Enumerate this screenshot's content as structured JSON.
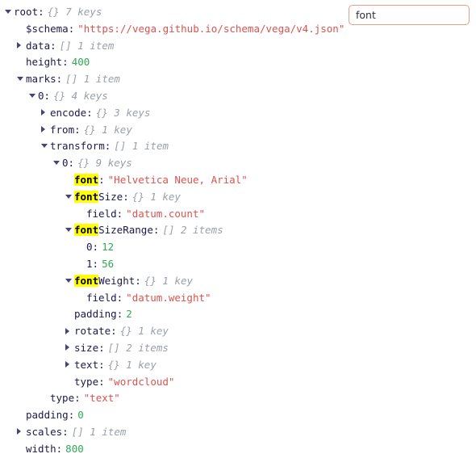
{
  "search": {
    "value": "font",
    "placeholder": "",
    "name": "search-input"
  },
  "tree": {
    "rows": [
      {
        "indent": 0,
        "toggle": "open",
        "key": "root",
        "hlen": 0,
        "meta": "{}  7 keys",
        "value": "",
        "valueType": "none"
      },
      {
        "indent": 1,
        "toggle": "none",
        "key": "$schema",
        "hlen": 0,
        "meta": "",
        "value": "\"https://vega.github.io/schema/vega/v4.json\"",
        "valueType": "string"
      },
      {
        "indent": 1,
        "toggle": "closed",
        "key": "data",
        "hlen": 0,
        "meta": "[]  1 item",
        "value": "",
        "valueType": "none"
      },
      {
        "indent": 1,
        "toggle": "none",
        "key": "height",
        "hlen": 0,
        "meta": "",
        "value": "400",
        "valueType": "number"
      },
      {
        "indent": 1,
        "toggle": "open",
        "key": "marks",
        "hlen": 0,
        "meta": "[]  1 item",
        "value": "",
        "valueType": "none"
      },
      {
        "indent": 2,
        "toggle": "open",
        "key": "0",
        "hlen": 0,
        "meta": "{}  4 keys",
        "value": "",
        "valueType": "none"
      },
      {
        "indent": 3,
        "toggle": "closed",
        "key": "encode",
        "hlen": 0,
        "meta": "{}  3 keys",
        "value": "",
        "valueType": "none"
      },
      {
        "indent": 3,
        "toggle": "closed",
        "key": "from",
        "hlen": 0,
        "meta": "{}  1 key",
        "value": "",
        "valueType": "none"
      },
      {
        "indent": 3,
        "toggle": "open",
        "key": "transform",
        "hlen": 0,
        "meta": "[]  1 item",
        "value": "",
        "valueType": "none"
      },
      {
        "indent": 4,
        "toggle": "open",
        "key": "0",
        "hlen": 0,
        "meta": "{}  9 keys",
        "value": "",
        "valueType": "none"
      },
      {
        "indent": 5,
        "toggle": "none",
        "key": "font",
        "hlen": 4,
        "meta": "",
        "value": "\"Helvetica Neue, Arial\"",
        "valueType": "string"
      },
      {
        "indent": 5,
        "toggle": "open",
        "key": "fontSize",
        "hlen": 4,
        "meta": "{}  1 key",
        "value": "",
        "valueType": "none"
      },
      {
        "indent": 6,
        "toggle": "none",
        "key": "field",
        "hlen": 0,
        "meta": "",
        "value": "\"datum.count\"",
        "valueType": "string"
      },
      {
        "indent": 5,
        "toggle": "open",
        "key": "fontSizeRange",
        "hlen": 4,
        "meta": "[]  2 items",
        "value": "",
        "valueType": "none"
      },
      {
        "indent": 6,
        "toggle": "none",
        "key": "0",
        "hlen": 0,
        "meta": "",
        "value": "12",
        "valueType": "number"
      },
      {
        "indent": 6,
        "toggle": "none",
        "key": "1",
        "hlen": 0,
        "meta": "",
        "value": "56",
        "valueType": "number"
      },
      {
        "indent": 5,
        "toggle": "open",
        "key": "fontWeight",
        "hlen": 4,
        "meta": "{}  1 key",
        "value": "",
        "valueType": "none"
      },
      {
        "indent": 6,
        "toggle": "none",
        "key": "field",
        "hlen": 0,
        "meta": "",
        "value": "\"datum.weight\"",
        "valueType": "string"
      },
      {
        "indent": 5,
        "toggle": "none",
        "key": "padding",
        "hlen": 0,
        "meta": "",
        "value": "2",
        "valueType": "number"
      },
      {
        "indent": 5,
        "toggle": "closed",
        "key": "rotate",
        "hlen": 0,
        "meta": "{}  1 key",
        "value": "",
        "valueType": "none"
      },
      {
        "indent": 5,
        "toggle": "closed",
        "key": "size",
        "hlen": 0,
        "meta": "[]  2 items",
        "value": "",
        "valueType": "none"
      },
      {
        "indent": 5,
        "toggle": "closed",
        "key": "text",
        "hlen": 0,
        "meta": "{}  1 key",
        "value": "",
        "valueType": "none"
      },
      {
        "indent": 5,
        "toggle": "none",
        "key": "type",
        "hlen": 0,
        "meta": "",
        "value": "\"wordcloud\"",
        "valueType": "string"
      },
      {
        "indent": 3,
        "toggle": "none",
        "key": "type",
        "hlen": 0,
        "meta": "",
        "value": "\"text\"",
        "valueType": "string"
      },
      {
        "indent": 1,
        "toggle": "none",
        "key": "padding",
        "hlen": 0,
        "meta": "",
        "value": "0",
        "valueType": "number"
      },
      {
        "indent": 1,
        "toggle": "closed",
        "key": "scales",
        "hlen": 0,
        "meta": "[]  1 item",
        "value": "",
        "valueType": "none"
      },
      {
        "indent": 1,
        "toggle": "none",
        "key": "width",
        "hlen": 0,
        "meta": "",
        "value": "800",
        "valueType": "number"
      }
    ]
  },
  "colors": {
    "key": "#1a1a4a",
    "string_value": "#d9534f",
    "number_value": "#2eaa55",
    "meta": "#9aa0a8",
    "highlight": "#ffff00",
    "input_border": "#e4a086",
    "background": "#ffffff"
  }
}
